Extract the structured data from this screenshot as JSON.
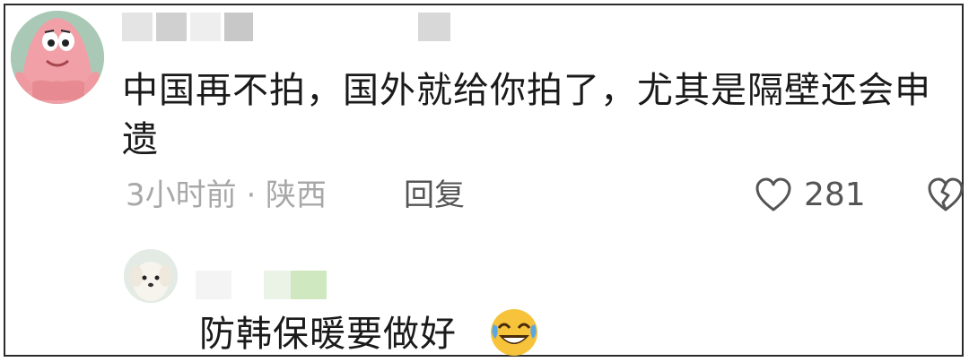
{
  "comment": {
    "text": "中国再不拍，国外就给你拍了，尤其是隔壁还会申遗",
    "meta": "3小时前 · 陕西",
    "reply_label": "回复",
    "like_count": "281",
    "like_icon": "heart-outline",
    "dislike_icon": "broken-heart-outline"
  },
  "reply": {
    "text": "防韩保暖要做好",
    "emoji": "rolling-on-floor-laughing"
  },
  "colors": {
    "text": "#1a1a1a",
    "meta": "#a8a8a8",
    "action": "#555555",
    "border": "#2a2a2a"
  }
}
